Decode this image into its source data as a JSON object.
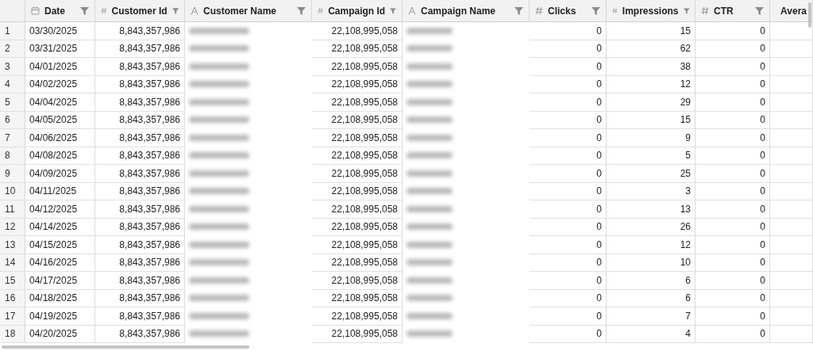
{
  "columns": [
    {
      "label": "Date",
      "kind": "date",
      "redacted": false
    },
    {
      "label": "Customer Id",
      "kind": "number",
      "redacted": false
    },
    {
      "label": "Customer Name",
      "kind": "text",
      "redacted": true
    },
    {
      "label": "Campaign Id",
      "kind": "number",
      "redacted": false
    },
    {
      "label": "Campaign Name",
      "kind": "text",
      "redacted": true
    },
    {
      "label": "Clicks",
      "kind": "number",
      "redacted": false
    },
    {
      "label": "Impressions",
      "kind": "number",
      "redacted": false
    },
    {
      "label": "CTR",
      "kind": "number",
      "redacted": false
    },
    {
      "label": "Avera",
      "kind": "number",
      "redacted": false
    }
  ],
  "rows": [
    {
      "number": "1",
      "values": [
        "03/30/2025",
        "8,843,357,986",
        "22,108,995,058",
        "0",
        "15",
        "0"
      ]
    },
    {
      "number": "2",
      "values": [
        "03/31/2025",
        "8,843,357,986",
        "22,108,995,058",
        "0",
        "62",
        "0"
      ]
    },
    {
      "number": "3",
      "values": [
        "04/01/2025",
        "8,843,357,986",
        "22,108,995,058",
        "0",
        "38",
        "0"
      ]
    },
    {
      "number": "4",
      "values": [
        "04/02/2025",
        "8,843,357,986",
        "22,108,995,058",
        "0",
        "12",
        "0"
      ]
    },
    {
      "number": "5",
      "values": [
        "04/04/2025",
        "8,843,357,986",
        "22,108,995,058",
        "0",
        "29",
        "0"
      ]
    },
    {
      "number": "6",
      "values": [
        "04/05/2025",
        "8,843,357,986",
        "22,108,995,058",
        "0",
        "15",
        "0"
      ]
    },
    {
      "number": "7",
      "values": [
        "04/06/2025",
        "8,843,357,986",
        "22,108,995,058",
        "0",
        "9",
        "0"
      ]
    },
    {
      "number": "8",
      "values": [
        "04/08/2025",
        "8,843,357,986",
        "22,108,995,058",
        "0",
        "5",
        "0"
      ]
    },
    {
      "number": "9",
      "values": [
        "04/09/2025",
        "8,843,357,986",
        "22,108,995,058",
        "0",
        "25",
        "0"
      ]
    },
    {
      "number": "10",
      "values": [
        "04/11/2025",
        "8,843,357,986",
        "22,108,995,058",
        "0",
        "3",
        "0"
      ]
    },
    {
      "number": "11",
      "values": [
        "04/12/2025",
        "8,843,357,986",
        "22,108,995,058",
        "0",
        "13",
        "0"
      ]
    },
    {
      "number": "12",
      "values": [
        "04/14/2025",
        "8,843,357,986",
        "22,108,995,058",
        "0",
        "26",
        "0"
      ]
    },
    {
      "number": "13",
      "values": [
        "04/15/2025",
        "8,843,357,986",
        "22,108,995,058",
        "0",
        "12",
        "0"
      ]
    },
    {
      "number": "14",
      "values": [
        "04/16/2025",
        "8,843,357,986",
        "22,108,995,058",
        "0",
        "10",
        "0"
      ]
    },
    {
      "number": "15",
      "values": [
        "04/17/2025",
        "8,843,357,986",
        "22,108,995,058",
        "0",
        "6",
        "0"
      ]
    },
    {
      "number": "16",
      "values": [
        "04/18/2025",
        "8,843,357,986",
        "22,108,995,058",
        "0",
        "6",
        "0"
      ]
    },
    {
      "number": "17",
      "values": [
        "04/19/2025",
        "8,843,357,986",
        "22,108,995,058",
        "0",
        "7",
        "0"
      ]
    },
    {
      "number": "18",
      "values": [
        "04/20/2025",
        "8,843,357,986",
        "22,108,995,058",
        "0",
        "4",
        "0"
      ]
    }
  ]
}
